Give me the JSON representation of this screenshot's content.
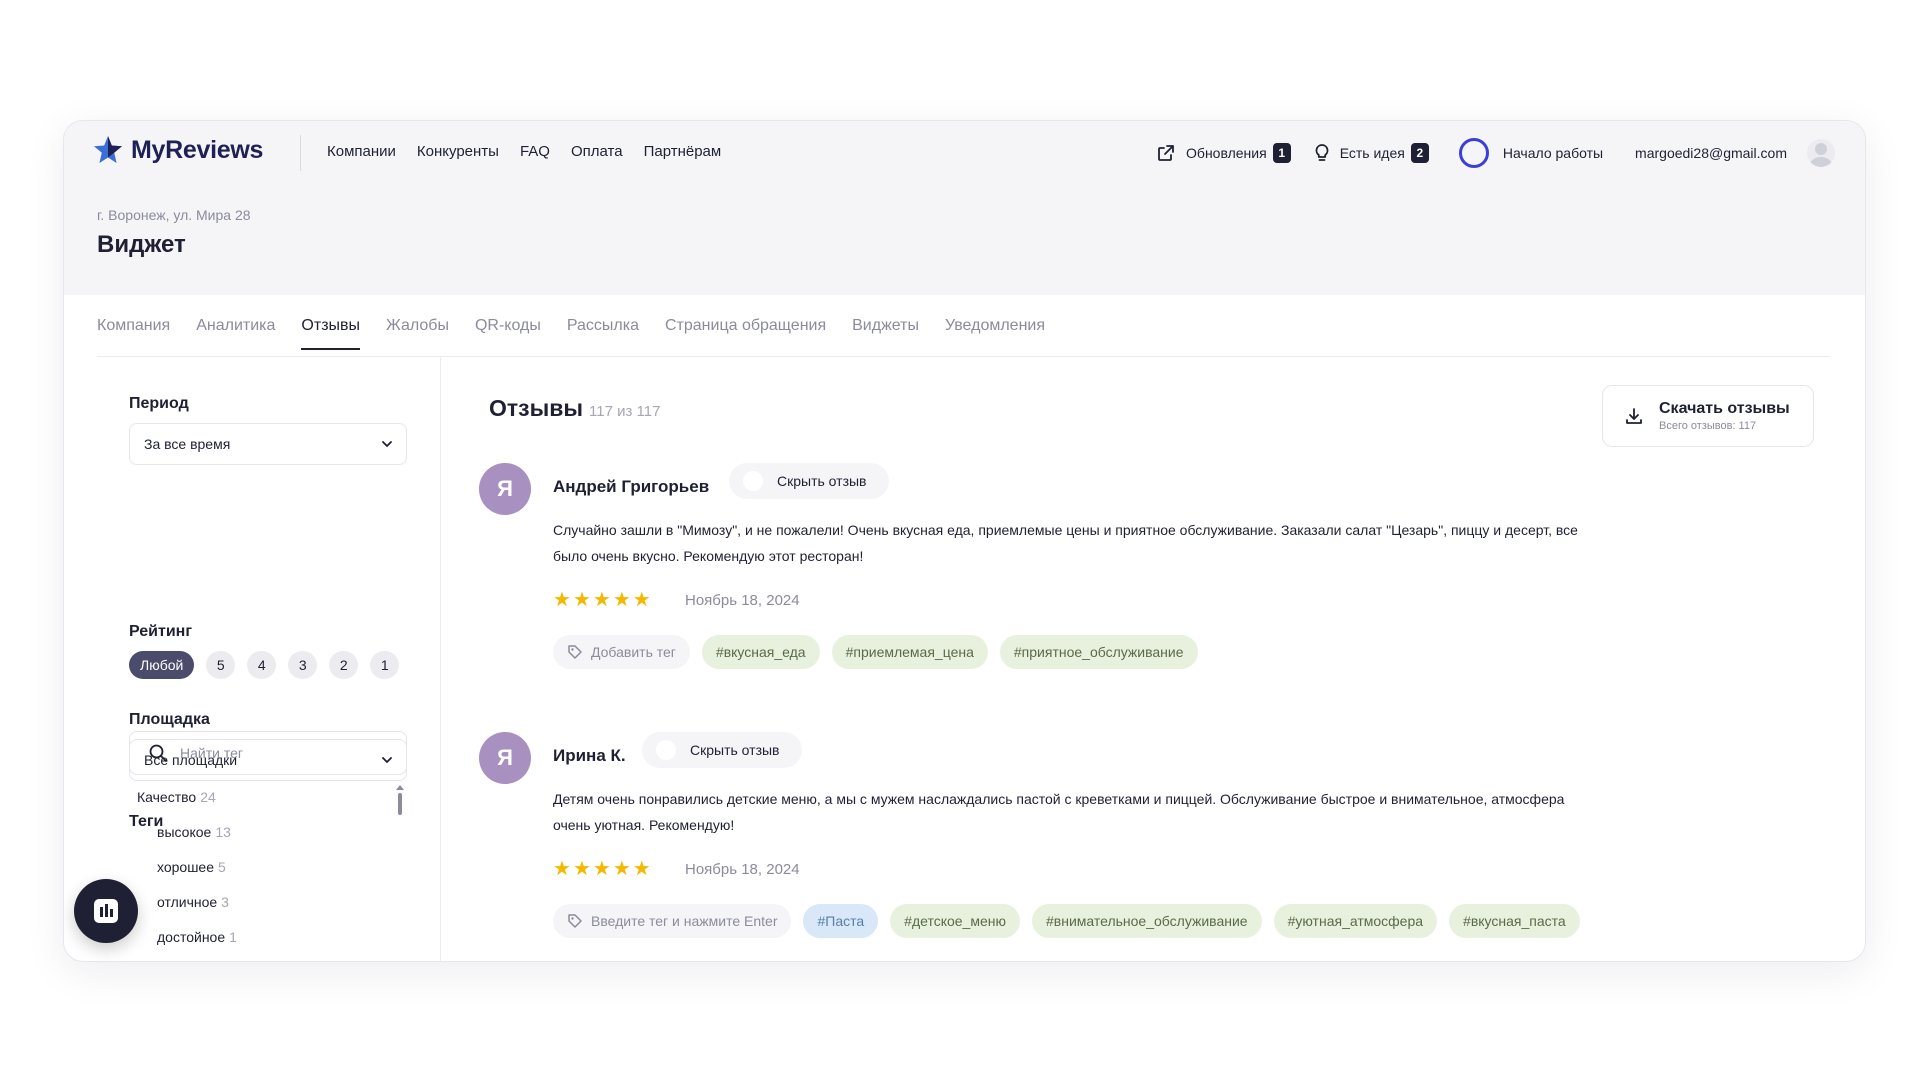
{
  "header": {
    "logo_text": "MyReviews",
    "nav": [
      "Компании",
      "Конкуренты",
      "FAQ",
      "Оплата",
      "Партнёрам"
    ],
    "updates_label": "Обновления",
    "updates_count": "1",
    "idea_label": "Есть идея",
    "idea_count": "2",
    "start_label": "Начало работы",
    "email": "margoedi28@gmail.com"
  },
  "page": {
    "address": "г. Воронеж, ул. Мира 28",
    "title": "Виджет"
  },
  "tabs": [
    "Компания",
    "Аналитика",
    "Отзывы",
    "Жалобы",
    "QR-коды",
    "Рассылка",
    "Страница обращения",
    "Виджеты",
    "Уведомления"
  ],
  "active_tab": "Отзывы",
  "sidebar": {
    "period_label": "Период",
    "period_value": "За все время",
    "rating_label": "Рейтинг",
    "rating_options": [
      "Любой",
      "5",
      "4",
      "3",
      "2",
      "1"
    ],
    "platform_label": "Площадка",
    "platform_value": "Все площадки",
    "tags_label": "Теги",
    "tag_search_placeholder": "Найти тег",
    "tag_group": {
      "label": "Качество",
      "count": "24"
    },
    "tag_children": [
      {
        "label": "высокое",
        "count": "13"
      },
      {
        "label": "хорошее",
        "count": "5"
      },
      {
        "label": "отличное",
        "count": "3"
      },
      {
        "label": "достойное",
        "count": "1"
      }
    ]
  },
  "main": {
    "title": "Отзывы",
    "count_text": "117 из 117",
    "download_label": "Скачать отзывы",
    "download_sub": "Всего отзывов: 117"
  },
  "reviews": [
    {
      "avatar_letter": "Я",
      "name": "Андрей Григорьев",
      "hide_label": "Скрыть отзыв",
      "text": "Случайно зашли в \"Мимозу\", и не пожалели! Очень вкусная еда, приемлемые цены и приятное обслуживание. Заказали салат \"Цезарь\", пиццу и десерт, все было очень вкусно. Рекомендую этот ресторан!",
      "rating": 5,
      "date": "Ноябрь 18, 2024",
      "add_tag_label": "Добавить тег",
      "tags": [
        "#вкусная_еда",
        "#приемлемая_цена",
        "#приятное_обслуживание"
      ]
    },
    {
      "avatar_letter": "Я",
      "name": "Ирина К.",
      "hide_label": "Скрыть отзыв",
      "text": "Детям очень понравились детские меню, а мы с мужем наслаждались пастой с креветками и пиццей. Обслуживание быстрое и внимательное, атмосфера очень уютная. Рекомендую!",
      "rating": 5,
      "date": "Ноябрь 18, 2024",
      "add_tag_label": "Введите тег и нажмите Enter",
      "tags": [
        "#Паста",
        "#детское_меню",
        "#внимательное_обслуживание",
        "#уютная_атмосфера",
        "#вкусная_паста"
      ]
    }
  ],
  "colors": {
    "brand_dark": "#1f2055",
    "star": "#f5b800",
    "avatar": "#a890c0",
    "tag_green": "#e8f1de",
    "tag_blue": "#d8e8f8",
    "accent_ring": "#3b3fd8"
  }
}
